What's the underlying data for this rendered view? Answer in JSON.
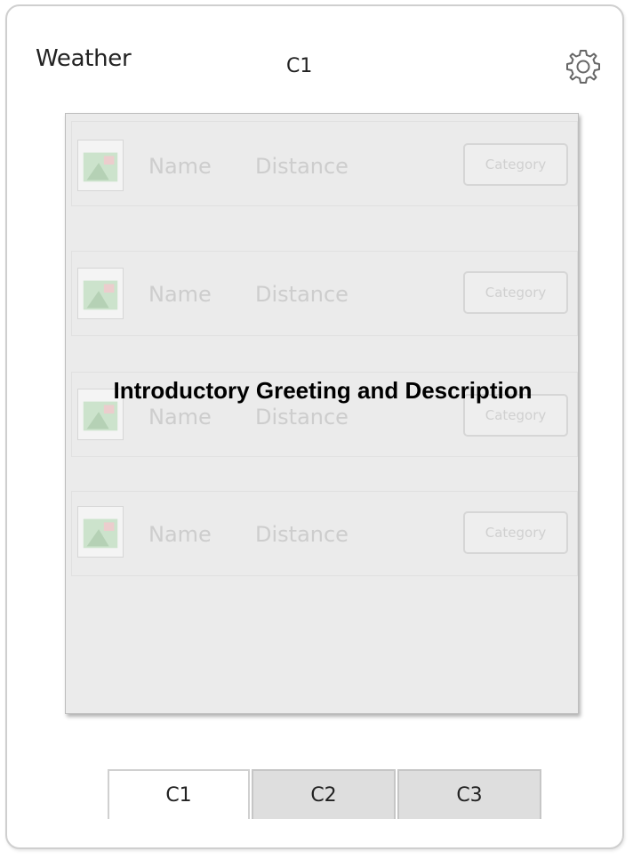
{
  "header": {
    "app_title": "Weather",
    "active_tab_label": "C1",
    "settings_icon": "gear-icon"
  },
  "overlay": {
    "greeting": "Introductory Greeting and Description",
    "items": [
      {
        "name": "Name",
        "distance": "Distance",
        "category": "Category",
        "icon": "image-placeholder-icon"
      },
      {
        "name": "Name",
        "distance": "Distance",
        "category": "Category",
        "icon": "image-placeholder-icon"
      },
      {
        "name": "Name",
        "distance": "Distance",
        "category": "Category",
        "icon": "image-placeholder-icon"
      },
      {
        "name": "Name",
        "distance": "Distance",
        "category": "Category",
        "icon": "image-placeholder-icon"
      }
    ]
  },
  "tabs": [
    {
      "label": "C1",
      "active": true
    },
    {
      "label": "C2",
      "active": false
    },
    {
      "label": "C3",
      "active": false
    }
  ]
}
